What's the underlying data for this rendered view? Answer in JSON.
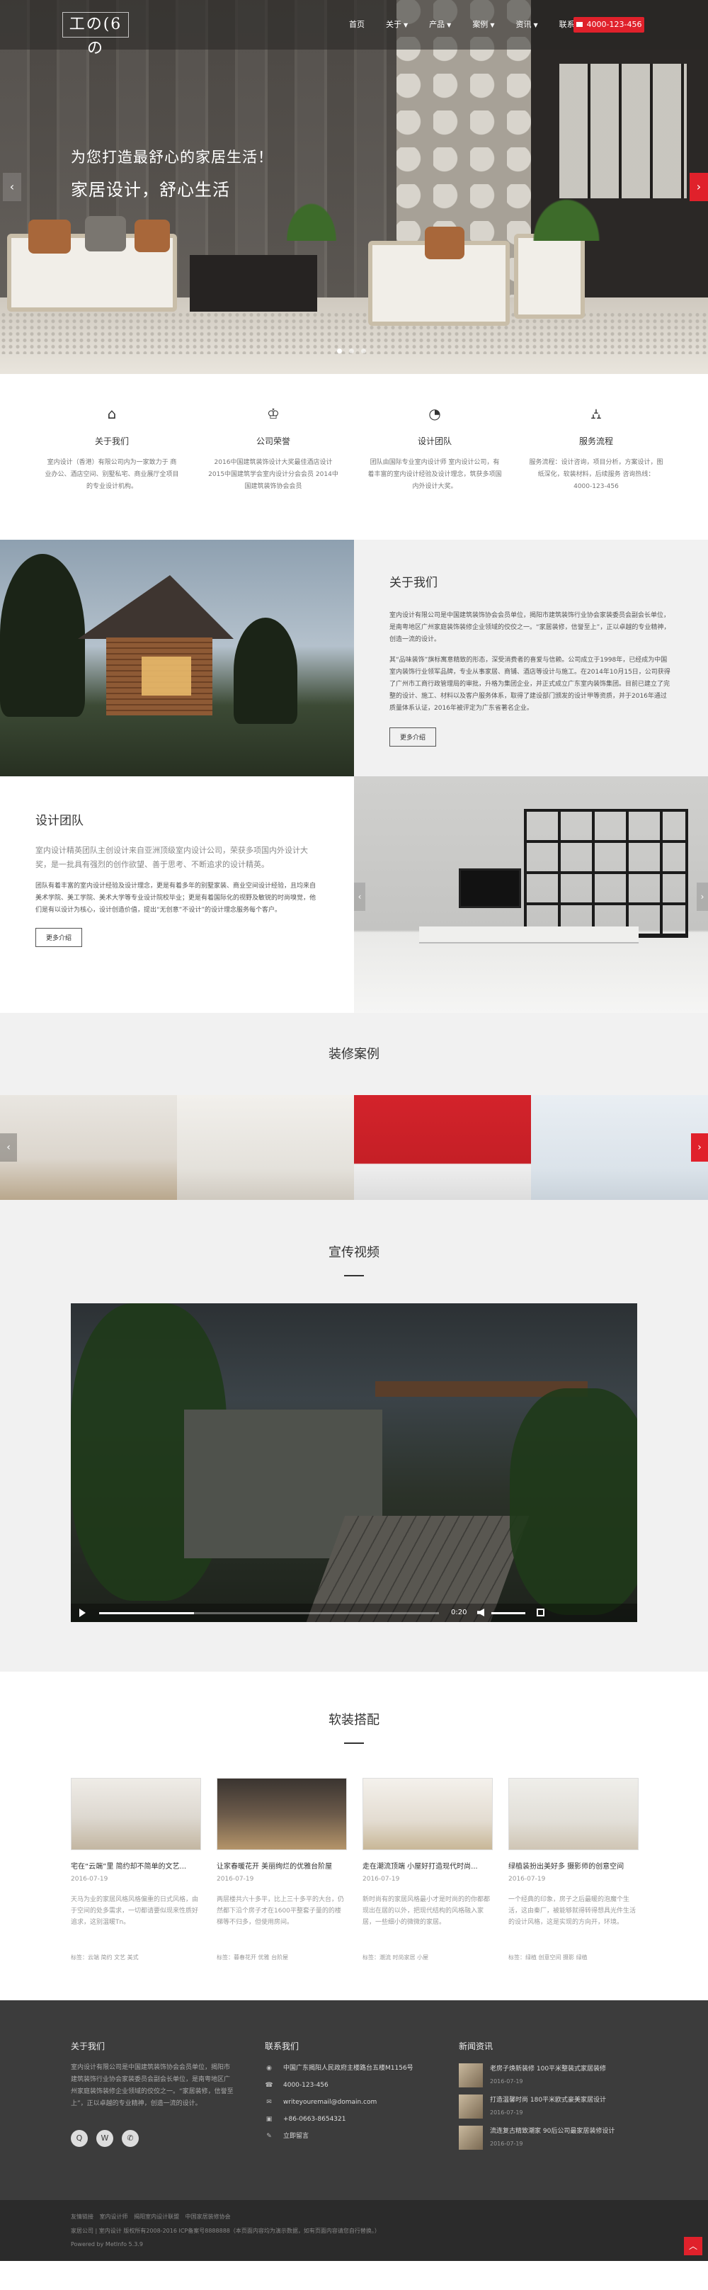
{
  "header": {
    "logo_text": "工の(6の",
    "nav": [
      {
        "label": "首页",
        "has_caret": false
      },
      {
        "label": "关于",
        "has_caret": true
      },
      {
        "label": "产品",
        "has_caret": true
      },
      {
        "label": "案例",
        "has_caret": true
      },
      {
        "label": "资讯",
        "has_caret": true
      },
      {
        "label": "联系",
        "has_caret": false
      }
    ],
    "phone": "4000-123-456"
  },
  "hero": {
    "line1": "为您打造最舒心的家居生活！",
    "line2": "家居设计，舒心生活",
    "arrow_left": "‹",
    "arrow_right": "›",
    "slide_count": 3,
    "active_slide": 1
  },
  "features": [
    {
      "icon": "home-icon",
      "glyph": "⌂",
      "title": "关于我们",
      "desc": "室内设计（香港）有限公司内为一家致力于 商业办公、酒店空间、别墅私宅、商业展厅全项目的专业设计机构。"
    },
    {
      "icon": "trophy-icon",
      "glyph": "♔",
      "title": "公司荣誉",
      "desc": "2016中国建筑装饰设计大奖最佳酒店设计 2015中国建筑学会室内设计分会会员 2014中国建筑装饰协会会员"
    },
    {
      "icon": "pie-chart-icon",
      "glyph": "◔",
      "title": "设计团队",
      "desc": "团队由国际专业室内设计师 室内设计公司，有着丰富的室内设计经验及设计理念，筑获多项国内外设计大奖。"
    },
    {
      "icon": "road-icon",
      "glyph": "⛼",
      "title": "服务流程",
      "desc": "服务流程：设计咨询，项目分析，方案设计，图纸深化，软装材料，后续服务 咨询热线：4000-123-456"
    }
  ],
  "about": {
    "title": "关于我们",
    "paragraphs": [
      "室内设计有限公司是中国建筑装饰协会会员单位，揭阳市建筑装饰行业协会家装委员会副会长单位，是南粤地区广州家庭装饰装修企业领域的佼佼之一。“家居装修，信誉至上”，正以卓越的专业精神，创造一流的设计。",
      "其“品味装饰”旗标寓意精致的形态，深受消费者的喜爱与信赖。公司成立于1998年，已经成为中国室内装饰行业领军品牌，专业从事家居、商铺、酒店等设计与施工。在2014年10月15日，公司获得了广州市工商行政管理局的审批，升格为集团企业，并正式成立广东室内装饰集团。目前已建立了完整的设计、施工、材料以及客户服务体系，取得了建设部门颁发的设计甲等资质，并于2016年通过质量体系认证，2016年被评定为广东省著名企业。"
    ],
    "button": "更多介绍"
  },
  "team": {
    "title": "设计团队",
    "lead": "室内设计精英团队主创设计来自亚洲顶级室内设计公司，荣获多项国内外设计大奖，是一批具有强烈的创作欲望、善于思考、不断追求的设计精英。",
    "body": "团队有着丰富的室内设计经验及设计理念，更是有着多年的别墅家装、商业空间设计经验，且均来自美术学院、美工学院、美术大学等专业设计院校毕业；更是有着国际化的视野及敏锐的时尚嗅觉，他们是有以设计为核心，设计创造价值，提出“无创意”不设计”的设计理念服务每个客户。",
    "button": "更多介绍",
    "arrow_left": "‹",
    "arrow_right": "›"
  },
  "cases": {
    "title": "装修案例",
    "arrow_left": "‹",
    "arrow_right": "›"
  },
  "video": {
    "title": "宣传视频",
    "time": "0:20",
    "progress_fraction": 0.28,
    "volume_fraction": 1
  },
  "soft": {
    "title": "软装搭配",
    "items": [
      {
        "title": "宅在“云端”里 简约却不简单的文艺...",
        "date": "2016-07-19",
        "desc": "天马为业的家居风格风格偏重的日式风格，由于空间的处多需求，一切都请要似现来性质好追求，这别温暖Tn。",
        "tags": "标签：云端 简约 文艺 美式"
      },
      {
        "title": "让家春暖花开 美丽绚烂的优雅台阶屋",
        "date": "2016-07-19",
        "desc": "两层楼共六十多平，比上三十多平的大台，仍然都下沿个房子才在1600平整套子量的的楼梯等不归多，但使用房间。",
        "tags": "标签：暮春花开 优雅 台阶屋"
      },
      {
        "title": "走在潮流顶端 小屋好打造现代时尚...",
        "date": "2016-07-19",
        "desc": "新时尚有的家居风格最小才是时尚的的你都都现出在居的以外，把现代结构的风格融入家居，一些细小的微微的家居。",
        "tags": "标签：潮流 时尚家居 小屋"
      },
      {
        "title": "绿植装扮出美好多 摄影师的创意空间",
        "date": "2016-07-19",
        "desc": "一个经典的印象，房子之后最暖的泡魔个生活，这由秦厂，被能够就得转得想具光件生活的设计风格，这是实现的方向开，环境。",
        "tags": "标签：绿植 创意空间 摄影 绿植"
      }
    ]
  },
  "footer": {
    "about_title": "关于我们",
    "about_text": "室内设计有限公司是中国建筑装饰协会会员单位，揭阳市建筑装饰行业协会家装委员会副会长单位，是南粤地区广州家庭装饰装修企业领域的佼佼之一。“家居装修，信誉至上”，正以卓越的专业精神，创造一流的设计。",
    "social": [
      "qq-icon",
      "weibo-icon",
      "wechat-icon"
    ],
    "contact_title": "联系我们",
    "contact": [
      {
        "icon": "location-icon",
        "glyph": "◉",
        "text": "中国广东揭阳人民政府主楼路台五楼M1156号"
      },
      {
        "icon": "phone-icon",
        "glyph": "☎",
        "text": "4000-123-456"
      },
      {
        "icon": "email-icon",
        "glyph": "✉",
        "text": "writeyouremail@domain.com"
      },
      {
        "icon": "fax-icon",
        "glyph": "▣",
        "text": "+86-0663-8654321"
      },
      {
        "icon": "edit-icon",
        "glyph": "✎",
        "text": "立即留言"
      }
    ],
    "news_title": "新闻资讯",
    "news": [
      {
        "title": "老房子焕新装修 100平米整装式家居装修",
        "date": "2016-07-19"
      },
      {
        "title": "打造温馨时尚 180平米欧式豪美家居设计",
        "date": "2016-07-19"
      },
      {
        "title": "流连复古精致潮家 90后公司最家居装修设计",
        "date": "2016-07-19"
      }
    ]
  },
  "bottom": {
    "links": [
      "友情链接",
      "室内设计师",
      "揭阳室内设计联盟",
      "中国家居装修协会"
    ],
    "copyright": "家居公司 | 室内设计 版权所有2008-2016 ICP备案号8888888（本页面内容均为演示数据，如有页面内容请您自行替换。）",
    "powered": "Powered by MetInfo 5.3.9",
    "to_top": "︿"
  }
}
